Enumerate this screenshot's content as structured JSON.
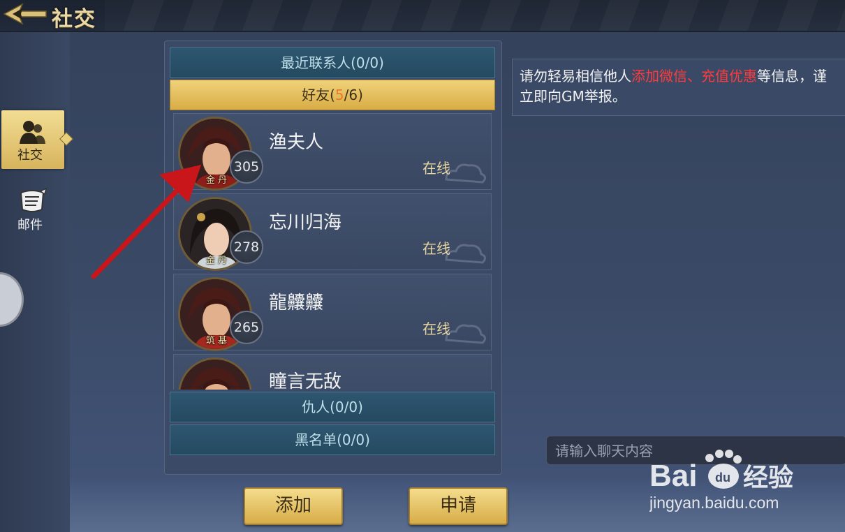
{
  "header": {
    "title": "社交"
  },
  "nav": {
    "items": [
      {
        "label": "社交",
        "icon": "social-icon",
        "active": true
      },
      {
        "label": "邮件",
        "icon": "mail-icon",
        "active": false
      }
    ]
  },
  "friends_panel": {
    "recent_contacts": "最近联系人(0/0)",
    "friends_prefix": "好友(",
    "friends_online": "5",
    "friends_suffix": "/6)",
    "enemies": "仇人(0/0)",
    "blacklist": "黑名单(0/0)",
    "friends": [
      {
        "name": "渔夫人",
        "level": "305",
        "rank": "金 丹",
        "status": "在线"
      },
      {
        "name": "忘川归海",
        "level": "278",
        "rank": "金 丹",
        "status": "在线"
      },
      {
        "name": "龍齉齉",
        "level": "265",
        "rank": "筑 基",
        "status": "在线"
      },
      {
        "name": "瞳言无敌",
        "level": "",
        "rank": "",
        "status": ""
      }
    ]
  },
  "chat": {
    "notice_part1": "请勿轻易相信他人",
    "notice_red1": "添加微信、充值优惠",
    "notice_part2": "等信息，谨",
    "notice_line2": "立即向GM举报。",
    "input_placeholder": "请输入聊天内容"
  },
  "buttons": {
    "add": "添加",
    "apply": "申请"
  },
  "watermark": {
    "brand": "Bai",
    "brand2": "经验",
    "url": "jingyan.baidu.com"
  },
  "colors": {
    "accent_gold": "#e0bd63",
    "warning_red": "#ff3b3b",
    "online_text": "#e8d79e"
  }
}
